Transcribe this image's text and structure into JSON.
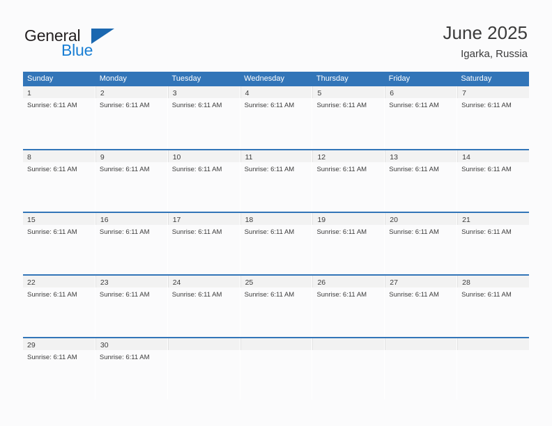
{
  "brand": {
    "word_one": "General",
    "word_two": "Blue",
    "flag_icon": "brand-flag-icon",
    "colors": {
      "general": "#231f20",
      "blue": "#1a7fd4",
      "flag": "#1b68b0"
    }
  },
  "header": {
    "title": "June 2025",
    "subtitle": "Igarka, Russia"
  },
  "theme": {
    "header_blue": "#3275b8",
    "row_divider_blue": "#3275b8",
    "day_band_gray": "#f2f2f2",
    "page_background": "#fbfbfc",
    "text": "#3b3b3b"
  },
  "calendar": {
    "day_headers": [
      "Sunday",
      "Monday",
      "Tuesday",
      "Wednesday",
      "Thursday",
      "Friday",
      "Saturday"
    ],
    "weeks": [
      [
        {
          "day": "1",
          "event": "Sunrise: 6:11 AM"
        },
        {
          "day": "2",
          "event": "Sunrise: 6:11 AM"
        },
        {
          "day": "3",
          "event": "Sunrise: 6:11 AM"
        },
        {
          "day": "4",
          "event": "Sunrise: 6:11 AM"
        },
        {
          "day": "5",
          "event": "Sunrise: 6:11 AM"
        },
        {
          "day": "6",
          "event": "Sunrise: 6:11 AM"
        },
        {
          "day": "7",
          "event": "Sunrise: 6:11 AM"
        }
      ],
      [
        {
          "day": "8",
          "event": "Sunrise: 6:11 AM"
        },
        {
          "day": "9",
          "event": "Sunrise: 6:11 AM"
        },
        {
          "day": "10",
          "event": "Sunrise: 6:11 AM"
        },
        {
          "day": "11",
          "event": "Sunrise: 6:11 AM"
        },
        {
          "day": "12",
          "event": "Sunrise: 6:11 AM"
        },
        {
          "day": "13",
          "event": "Sunrise: 6:11 AM"
        },
        {
          "day": "14",
          "event": "Sunrise: 6:11 AM"
        }
      ],
      [
        {
          "day": "15",
          "event": "Sunrise: 6:11 AM"
        },
        {
          "day": "16",
          "event": "Sunrise: 6:11 AM"
        },
        {
          "day": "17",
          "event": "Sunrise: 6:11 AM"
        },
        {
          "day": "18",
          "event": "Sunrise: 6:11 AM"
        },
        {
          "day": "19",
          "event": "Sunrise: 6:11 AM"
        },
        {
          "day": "20",
          "event": "Sunrise: 6:11 AM"
        },
        {
          "day": "21",
          "event": "Sunrise: 6:11 AM"
        }
      ],
      [
        {
          "day": "22",
          "event": "Sunrise: 6:11 AM"
        },
        {
          "day": "23",
          "event": "Sunrise: 6:11 AM"
        },
        {
          "day": "24",
          "event": "Sunrise: 6:11 AM"
        },
        {
          "day": "25",
          "event": "Sunrise: 6:11 AM"
        },
        {
          "day": "26",
          "event": "Sunrise: 6:11 AM"
        },
        {
          "day": "27",
          "event": "Sunrise: 6:11 AM"
        },
        {
          "day": "28",
          "event": "Sunrise: 6:11 AM"
        }
      ],
      [
        {
          "day": "29",
          "event": "Sunrise: 6:11 AM"
        },
        {
          "day": "30",
          "event": "Sunrise: 6:11 AM"
        },
        {
          "day": "",
          "event": ""
        },
        {
          "day": "",
          "event": ""
        },
        {
          "day": "",
          "event": ""
        },
        {
          "day": "",
          "event": ""
        },
        {
          "day": "",
          "event": ""
        }
      ]
    ]
  }
}
